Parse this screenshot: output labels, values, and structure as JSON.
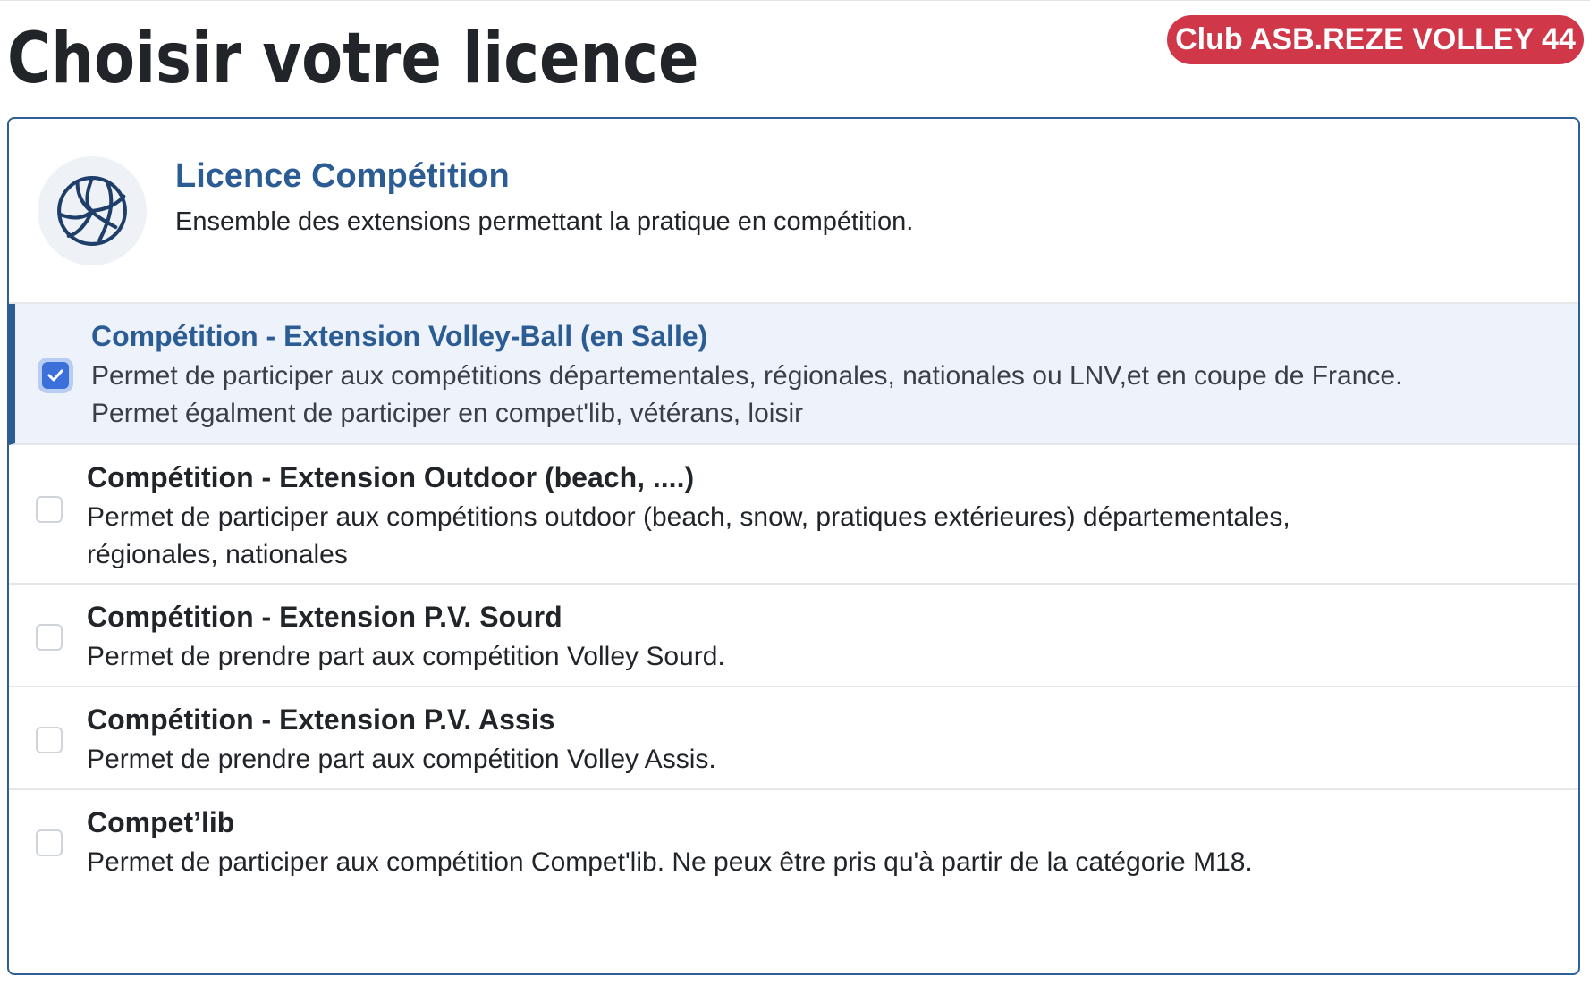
{
  "page": {
    "title": "Choisir votre licence",
    "club_badge": "Club ASB.REZE VOLLEY 44"
  },
  "licence": {
    "icon": "volleyball-icon",
    "title": "Licence Compétition",
    "description": "Ensemble des extensions permettant la pratique en compétition.",
    "accent_color": "#2b5c94",
    "options": [
      {
        "checked": true,
        "title": "Compétition - Extension Volley-Ball (en Salle)",
        "description_lines": [
          "Permet de participer aux compétitions départementales, régionales, nationales ou LNV,et en coupe de France.",
          "Permet égalment de participer en compet'lib, vétérans, loisir"
        ]
      },
      {
        "checked": false,
        "title": "Compétition - Extension Outdoor (beach, ....)",
        "description_lines": [
          "Permet de participer aux compétitions outdoor (beach, snow, pratiques extérieures) départementales,",
          "régionales, nationales"
        ]
      },
      {
        "checked": false,
        "title": "Compétition - Extension P.V. Sourd",
        "description_lines": [
          "Permet de prendre part aux compétition Volley Sourd."
        ]
      },
      {
        "checked": false,
        "title": "Compétition - Extension P.V. Assis",
        "description_lines": [
          "Permet de prendre part aux compétition Volley Assis."
        ]
      },
      {
        "checked": false,
        "title": "Compet’lib",
        "description_lines": [
          "Permet de participer aux compétition Compet'lib. Ne peux être pris qu'à partir de la catégorie M18."
        ]
      }
    ]
  },
  "colors": {
    "badge": "#d0384a",
    "selected_bg": "#eef3fb",
    "checkbox_checked": "#3b6fd9",
    "card_border": "#2e5f97"
  }
}
